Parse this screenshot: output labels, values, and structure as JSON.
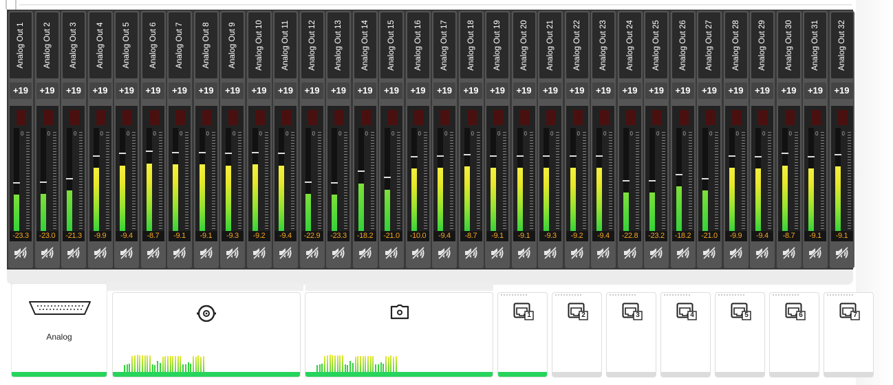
{
  "colors": {
    "accent_green": "#27d45c",
    "meter_green": "#32d23a",
    "meter_yellow": "#e8e82a",
    "readout_orange": "#f5a623",
    "strip_bg": "#3a3a3a"
  },
  "channels": [
    {
      "name": "Analog Out 1",
      "gain": "+19",
      "level": "-23.3",
      "fill": 0.36
    },
    {
      "name": "Analog Out 2",
      "gain": "+19",
      "level": "-23.0",
      "fill": 0.37
    },
    {
      "name": "Analog Out 3",
      "gain": "+19",
      "level": "-21.3",
      "fill": 0.4
    },
    {
      "name": "Analog Out 4",
      "gain": "+19",
      "level": "-9.9",
      "fill": 0.62
    },
    {
      "name": "Analog Out 5",
      "gain": "+19",
      "level": "-9.4",
      "fill": 0.64
    },
    {
      "name": "Analog Out 6",
      "gain": "+19",
      "level": "-8.7",
      "fill": 0.66
    },
    {
      "name": "Analog Out 7",
      "gain": "+19",
      "level": "-9.1",
      "fill": 0.65
    },
    {
      "name": "Analog Out 8",
      "gain": "+19",
      "level": "-9.1",
      "fill": 0.65
    },
    {
      "name": "Analog Out 9",
      "gain": "+19",
      "level": "-9.3",
      "fill": 0.64
    },
    {
      "name": "Analog Out 10",
      "gain": "+19",
      "level": "-9.2",
      "fill": 0.65
    },
    {
      "name": "Analog Out 11",
      "gain": "+19",
      "level": "-9.4",
      "fill": 0.64
    },
    {
      "name": "Analog Out 12",
      "gain": "+19",
      "level": "-22.9",
      "fill": 0.37
    },
    {
      "name": "Analog Out 13",
      "gain": "+19",
      "level": "-23.3",
      "fill": 0.36
    },
    {
      "name": "Analog Out 14",
      "gain": "+19",
      "level": "-18.2",
      "fill": 0.47
    },
    {
      "name": "Analog Out 15",
      "gain": "+19",
      "level": "-21.0",
      "fill": 0.41
    },
    {
      "name": "Analog Out 16",
      "gain": "+19",
      "level": "-10.0",
      "fill": 0.61
    },
    {
      "name": "Analog Out 17",
      "gain": "+19",
      "level": "-9.4",
      "fill": 0.62
    },
    {
      "name": "Analog Out 18",
      "gain": "+19",
      "level": "-8.7",
      "fill": 0.63
    },
    {
      "name": "Analog Out 19",
      "gain": "+19",
      "level": "-9.1",
      "fill": 0.62
    },
    {
      "name": "Analog Out 20",
      "gain": "+19",
      "level": "-9.1",
      "fill": 0.62
    },
    {
      "name": "Analog Out 21",
      "gain": "+19",
      "level": "-9.3",
      "fill": 0.62
    },
    {
      "name": "Analog Out 22",
      "gain": "+19",
      "level": "-9.2",
      "fill": 0.62
    },
    {
      "name": "Analog Out 23",
      "gain": "+19",
      "level": "-9.4",
      "fill": 0.62
    },
    {
      "name": "Analog Out 24",
      "gain": "+19",
      "level": "-22.8",
      "fill": 0.38
    },
    {
      "name": "Analog Out 25",
      "gain": "+19",
      "level": "-23.2",
      "fill": 0.38
    },
    {
      "name": "Analog Out 26",
      "gain": "+19",
      "level": "-18.2",
      "fill": 0.44
    },
    {
      "name": "Analog Out 27",
      "gain": "+19",
      "level": "-21.0",
      "fill": 0.4
    },
    {
      "name": "Analog Out 28",
      "gain": "+19",
      "level": "-9.9",
      "fill": 0.62
    },
    {
      "name": "Analog Out 29",
      "gain": "+19",
      "level": "-9.4",
      "fill": 0.61
    },
    {
      "name": "Analog Out 30",
      "gain": "+19",
      "level": "-8.7",
      "fill": 0.64
    },
    {
      "name": "Analog Out 31",
      "gain": "+19",
      "level": "-9.1",
      "fill": 0.61
    },
    {
      "name": "Analog Out 32",
      "gain": "+19",
      "level": "-9.1",
      "fill": 0.63
    }
  ],
  "device_cards": {
    "analog": {
      "label": "Analog",
      "icon": "db25-connector-icon"
    },
    "bnc": {
      "icon": "bnc-connector-icon"
    },
    "optical": {
      "icon": "optical-connector-icon"
    },
    "network_ports": [
      {
        "label": "1",
        "icon": "ethernet-port-icon"
      },
      {
        "label": "2",
        "icon": "ethernet-port-icon"
      },
      {
        "label": "3",
        "icon": "ethernet-port-icon"
      },
      {
        "label": "4",
        "icon": "ethernet-port-icon"
      },
      {
        "label": "5",
        "icon": "ethernet-port-icon"
      },
      {
        "label": "6",
        "icon": "ethernet-port-icon"
      },
      {
        "label": "7",
        "icon": "ethernet-port-icon"
      }
    ]
  }
}
